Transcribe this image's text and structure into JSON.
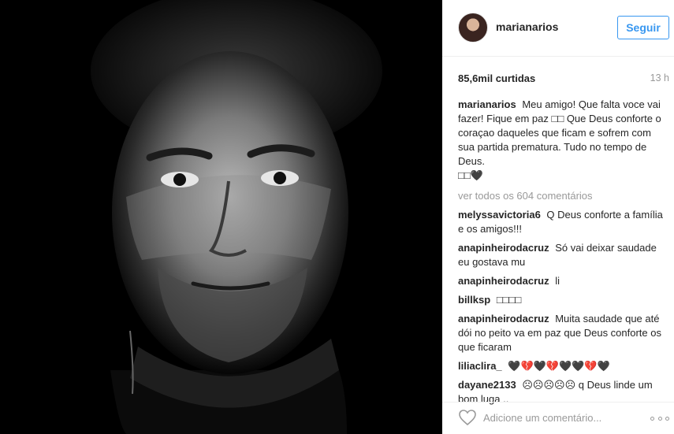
{
  "post": {
    "username": "marianarios",
    "follow_label": "Seguir",
    "likes": "85,6mil curtidas",
    "time": "13 h",
    "caption": {
      "user": "marianarios",
      "text": "Meu amigo! Que falta voce vai fazer! Fique em paz □□ Que Deus conforte o coraçao daqueles que ficam e sofrem com sua partida prematura. Tudo no tempo de Deus.",
      "tail": "□□🖤"
    },
    "view_all": "ver todos os 604 comentários",
    "comments": [
      {
        "user": "melyssavictoria6",
        "text": "Q Deus conforte a família e os amigos!!!"
      },
      {
        "user": "anapinheirodacruz",
        "text": "Só vai deixar saudade eu gostava mu"
      },
      {
        "user": "anapinheirodacruz",
        "text": "li"
      },
      {
        "user": "billksp",
        "text": "□□□□"
      },
      {
        "user": "anapinheirodacruz",
        "text": "Muita saudade que até dói no peito va em paz que Deus conforte os que ficaram"
      },
      {
        "user": "liliaclira_",
        "text": "🖤💔🖤💔🖤🖤💔🖤"
      },
      {
        "user": "dayane2133",
        "text": "☹☹☹☹☹ q Deus linde um bom luga .."
      }
    ],
    "comment_placeholder": "Adicione um comentário...",
    "icons": {
      "like": "heart-icon",
      "more": "more-options-icon"
    }
  }
}
